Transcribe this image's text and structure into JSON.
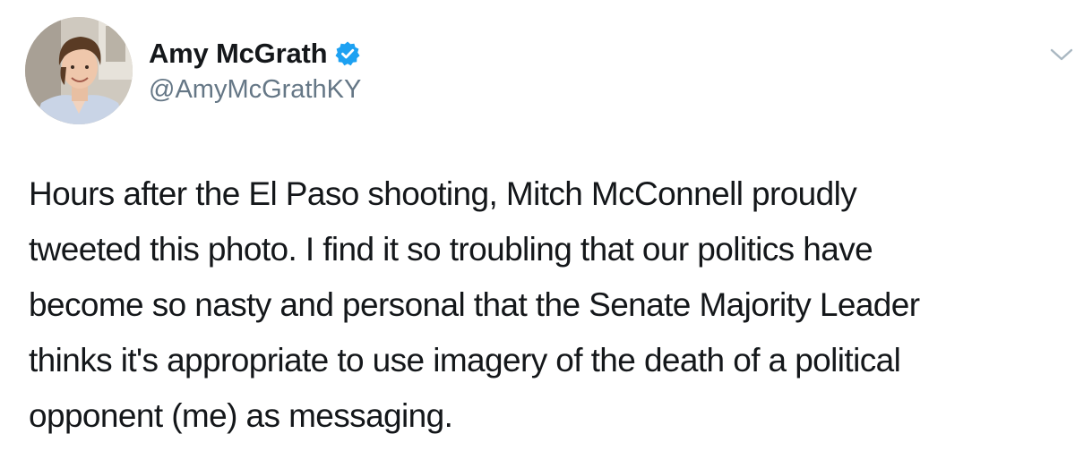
{
  "author": {
    "display_name": "Amy McGrath",
    "handle": "@AmyMcGrathKY",
    "verified": true,
    "verified_icon": "verified-badge-icon",
    "avatar_icon": "profile-photo"
  },
  "menu": {
    "icon": "chevron-down-icon"
  },
  "tweet": {
    "lines": [
      "Hours after the El Paso shooting, Mitch McConnell proudly",
      "tweeted this photo. I find it so troubling that our politics have",
      "become so nasty and personal that the Senate Majority Leader",
      "thinks it's appropriate to use imagery of the death of a political",
      "opponent (me) as messaging."
    ]
  },
  "colors": {
    "text": "#14171a",
    "secondary": "#657786",
    "verified_blue": "#1da1f2",
    "background": "#ffffff"
  }
}
